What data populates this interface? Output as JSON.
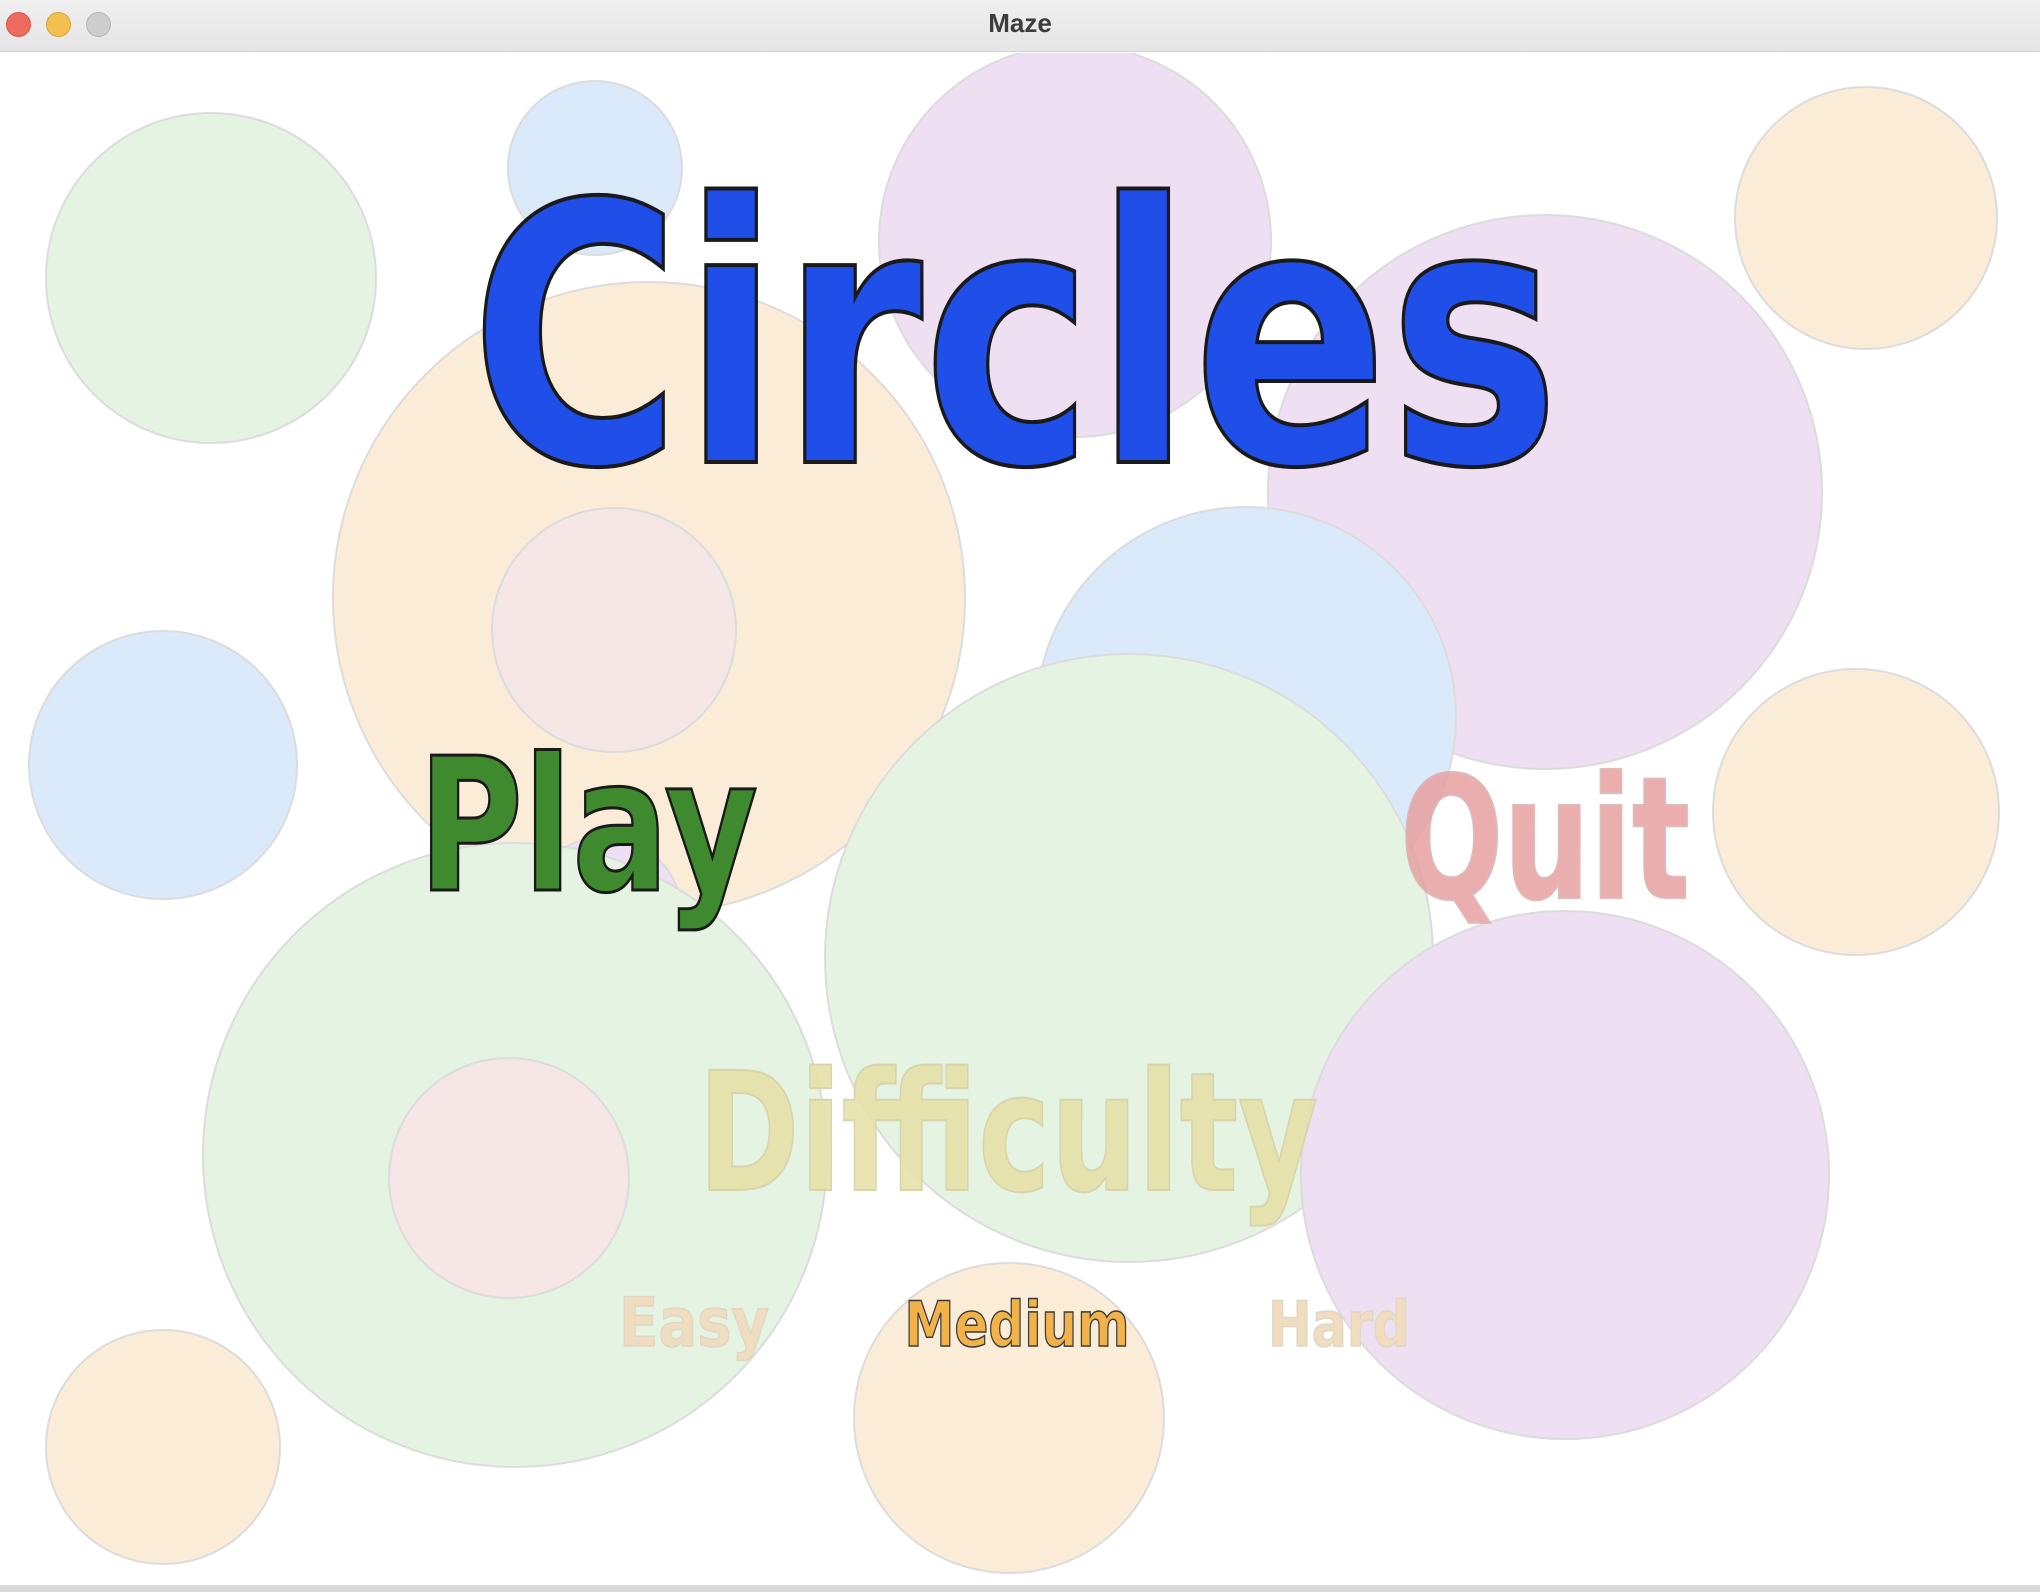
{
  "window": {
    "title": "Maze"
  },
  "menu": {
    "game_title": "Circles",
    "play_label": "Play",
    "quit_label": "Quit",
    "difficulty_label": "Difficulty",
    "difficulty_options": [
      "Easy",
      "Medium",
      "Hard"
    ],
    "selected_difficulty": "Medium"
  },
  "colors": {
    "title": "#1f4fe8",
    "play": "#3f8a2f",
    "quit": "#e8a0a0",
    "difficulty": "#e6e1a8",
    "option_inactive": "#f0ddc0",
    "option_selected": "#f2b24a",
    "circle_green": "#e5f3e3",
    "circle_blue": "#dbeafa",
    "circle_purple": "#eedff2",
    "circle_orange": "#fbecd8",
    "circle_pink": "#f6e6e6"
  }
}
